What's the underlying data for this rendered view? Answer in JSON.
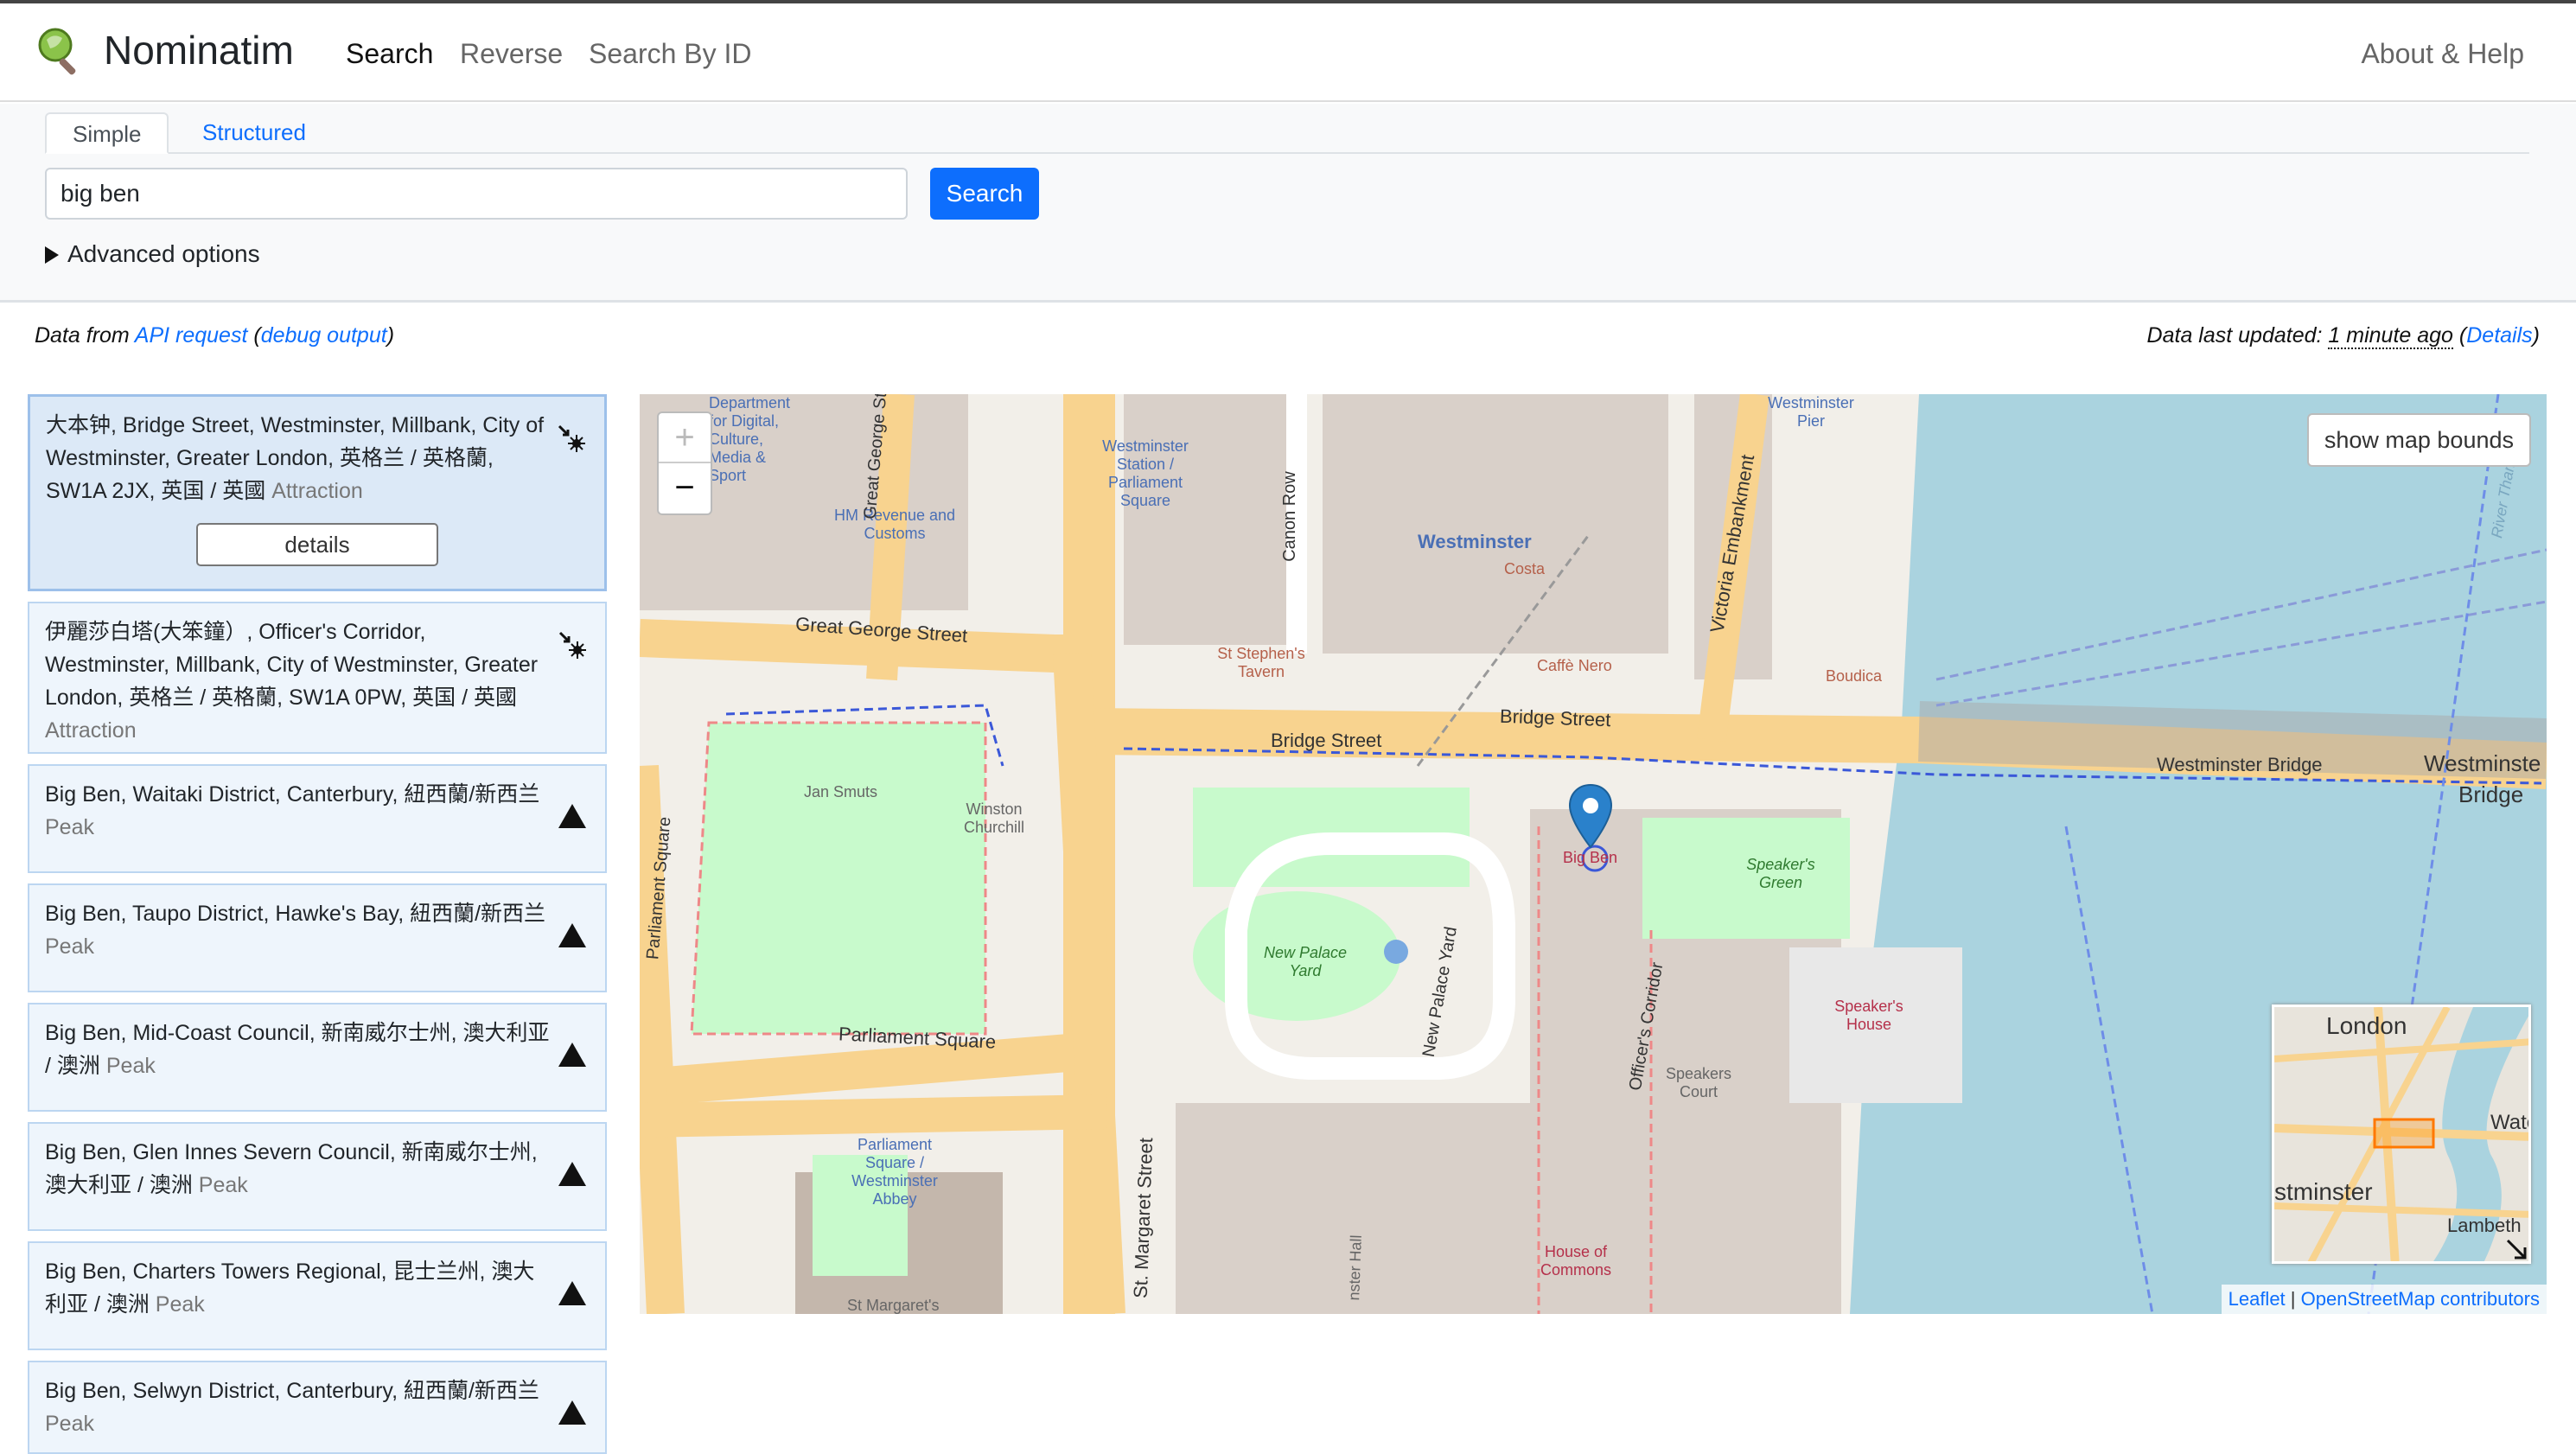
{
  "header": {
    "brand": "Nominatim",
    "nav": {
      "search": "Search",
      "reverse": "Reverse",
      "search_by_id": "Search By ID",
      "about": "About & Help"
    }
  },
  "search": {
    "tabs": {
      "simple": "Simple",
      "structured": "Structured"
    },
    "query": "big ben",
    "button": "Search",
    "advanced": "Advanced options"
  },
  "info": {
    "data_from": "Data from ",
    "api_request": "API request",
    "open_paren": " (",
    "debug_output": "debug output",
    "close_paren": ")",
    "last_updated_label": "Data last updated: ",
    "last_updated_value": "1 minute ago",
    "details": "Details"
  },
  "results": [
    {
      "text": "大本钟, Bridge Street, Westminster, Millbank, City of Westminster, Greater London, 英格兰 / 英格蘭, SW1A 2JX, 英国 / 英國",
      "type": "Attraction",
      "icon": "attraction-icon",
      "selected": true,
      "details_label": "details"
    },
    {
      "text": "伊麗莎白塔(大笨鐘）, Officer's Corridor, Westminster, Millbank, City of Westminster, Greater London, 英格兰 / 英格蘭, SW1A 0PW, 英国 / 英國",
      "type": "Attraction",
      "icon": "attraction-icon"
    },
    {
      "text": "Big Ben, Waitaki District, Canterbury, 紐西蘭/新西兰",
      "type": "Peak",
      "icon": "peak-icon"
    },
    {
      "text": "Big Ben, Taupo District, Hawke's Bay, 紐西蘭/新西兰",
      "type": "Peak",
      "icon": "peak-icon"
    },
    {
      "text": "Big Ben, Mid-Coast Council, 新南威尔士州, 澳大利亚 / 澳洲",
      "type": "Peak",
      "icon": "peak-icon"
    },
    {
      "text": "Big Ben, Glen Innes Severn Council, 新南威尔士州, 澳大利亚 / 澳洲",
      "type": "Peak",
      "icon": "peak-icon"
    },
    {
      "text": "Big Ben, Charters Towers Regional, 昆士兰州, 澳大利亚 / 澳洲",
      "type": "Peak",
      "icon": "peak-icon"
    },
    {
      "text": "Big Ben, Selwyn District, Canterbury, 紐西蘭/新西兰",
      "type": "Peak",
      "icon": "peak-icon"
    }
  ],
  "map": {
    "zoom_in": "+",
    "zoom_out": "−",
    "show_bounds": "show map bounds",
    "attribution": {
      "leaflet": "Leaflet",
      "separator": " | ",
      "osm": "OpenStreetMap contributors"
    },
    "labels": {
      "great_george": "Great George Street",
      "bridge_street_1": "Bridge Street",
      "bridge_street_2": "Bridge Street",
      "westminster_bridge": "Westminster Bridge",
      "westminster_bridge_2a": "Westminste",
      "westminster_bridge_2b": "Bridge",
      "parliament_square": "Parliament Square",
      "parliament_square_v": "Parliament Square",
      "westminster": "Westminster",
      "costa": "Costa",
      "caffe_nero": "Caffè Nero",
      "boudica": "Boudica",
      "st_stephens": "St Stephen's Tavern",
      "hm_revenue": "HM Revenue and Customs",
      "dept": "Department for Digital, Culture, Media & Sport",
      "westminster_station": "Westminster Station / Parliament Square",
      "westminster_pier": "Westminster Pier",
      "canon_row": "Canon Row",
      "victoria_embankment": "Victoria Embankment",
      "great_george_st_v": "Great George St",
      "jan_smuts": "Jan Smuts",
      "winston_churchill": "Winston Churchill",
      "new_palace_yard": "New Palace Yard",
      "new_palace_yard_road": "New Palace Yard",
      "speakers_green": "Speaker's Green",
      "big_ben": "Big Ben",
      "officers_corridor": "Officer's Corridor",
      "speakers_court": "Speakers Court",
      "speakers_house": "Speaker's House",
      "house_of_commons": "House of Commons",
      "st_margaret_street": "St. Margaret Street",
      "westminster_abbey": "Parliament Square / Westminster Abbey",
      "st_margarets": "St Margaret's",
      "westminster_hall": "nster Hall",
      "river_thames": "River Tham",
      "mini_london": "London",
      "mini_westminster": "stminster",
      "mini_lambeth": "Lambeth",
      "mini_wate": "Wate"
    }
  },
  "colors": {
    "accent": "#0d6efd",
    "selected_bg": "#dce9f7",
    "result_bg": "#eef5fc",
    "map_road": "#f8d38f",
    "map_water": "#aad3df",
    "map_green": "#c8facc",
    "marker": "#2a81cb"
  }
}
